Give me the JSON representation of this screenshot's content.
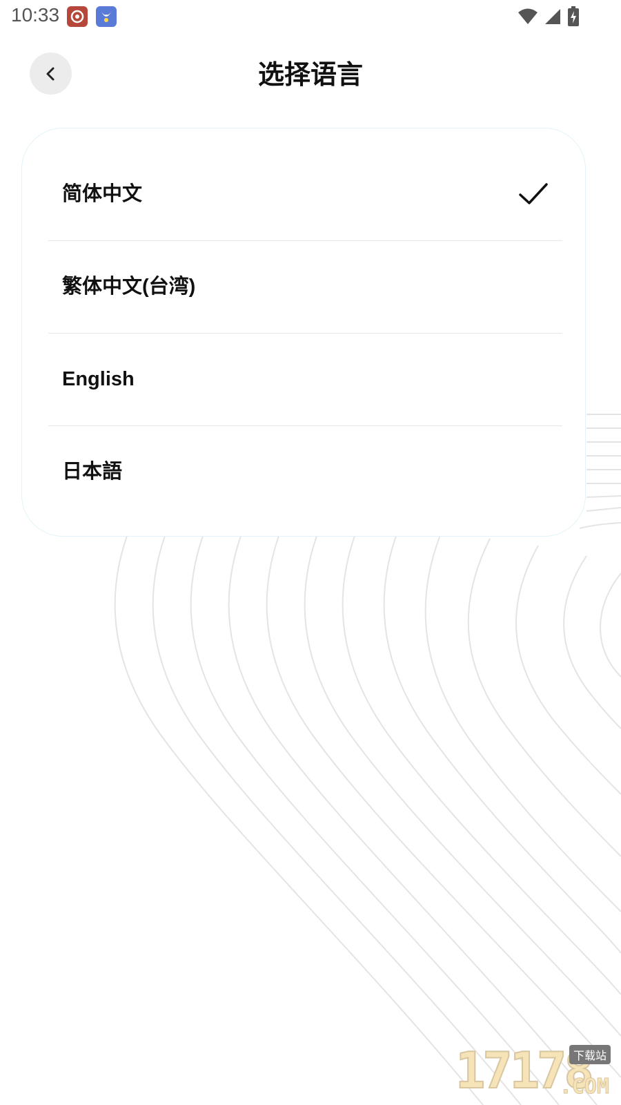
{
  "status_bar": {
    "time": "10:33",
    "app_icons": [
      "weibo-like-app-icon",
      "bird-app-icon"
    ],
    "indicators": [
      "wifi-icon",
      "cellular-signal-icon",
      "battery-charging-icon"
    ]
  },
  "header": {
    "title": "选择语言",
    "back_icon": "chevron-left-icon"
  },
  "languages": {
    "items": [
      {
        "label": "简体中文",
        "selected": true
      },
      {
        "label": "繁体中文(台湾)",
        "selected": false
      },
      {
        "label": "English",
        "selected": false
      },
      {
        "label": "日本語",
        "selected": false
      }
    ],
    "selected_icon": "checkmark-icon"
  },
  "watermark": {
    "number": "17178",
    "tag": "下载站",
    "domain": ".COM"
  },
  "colors": {
    "background": "#ffffff",
    "card_border": "#e2f3f8",
    "text": "#111111",
    "back_button_bg": "#ececec"
  }
}
